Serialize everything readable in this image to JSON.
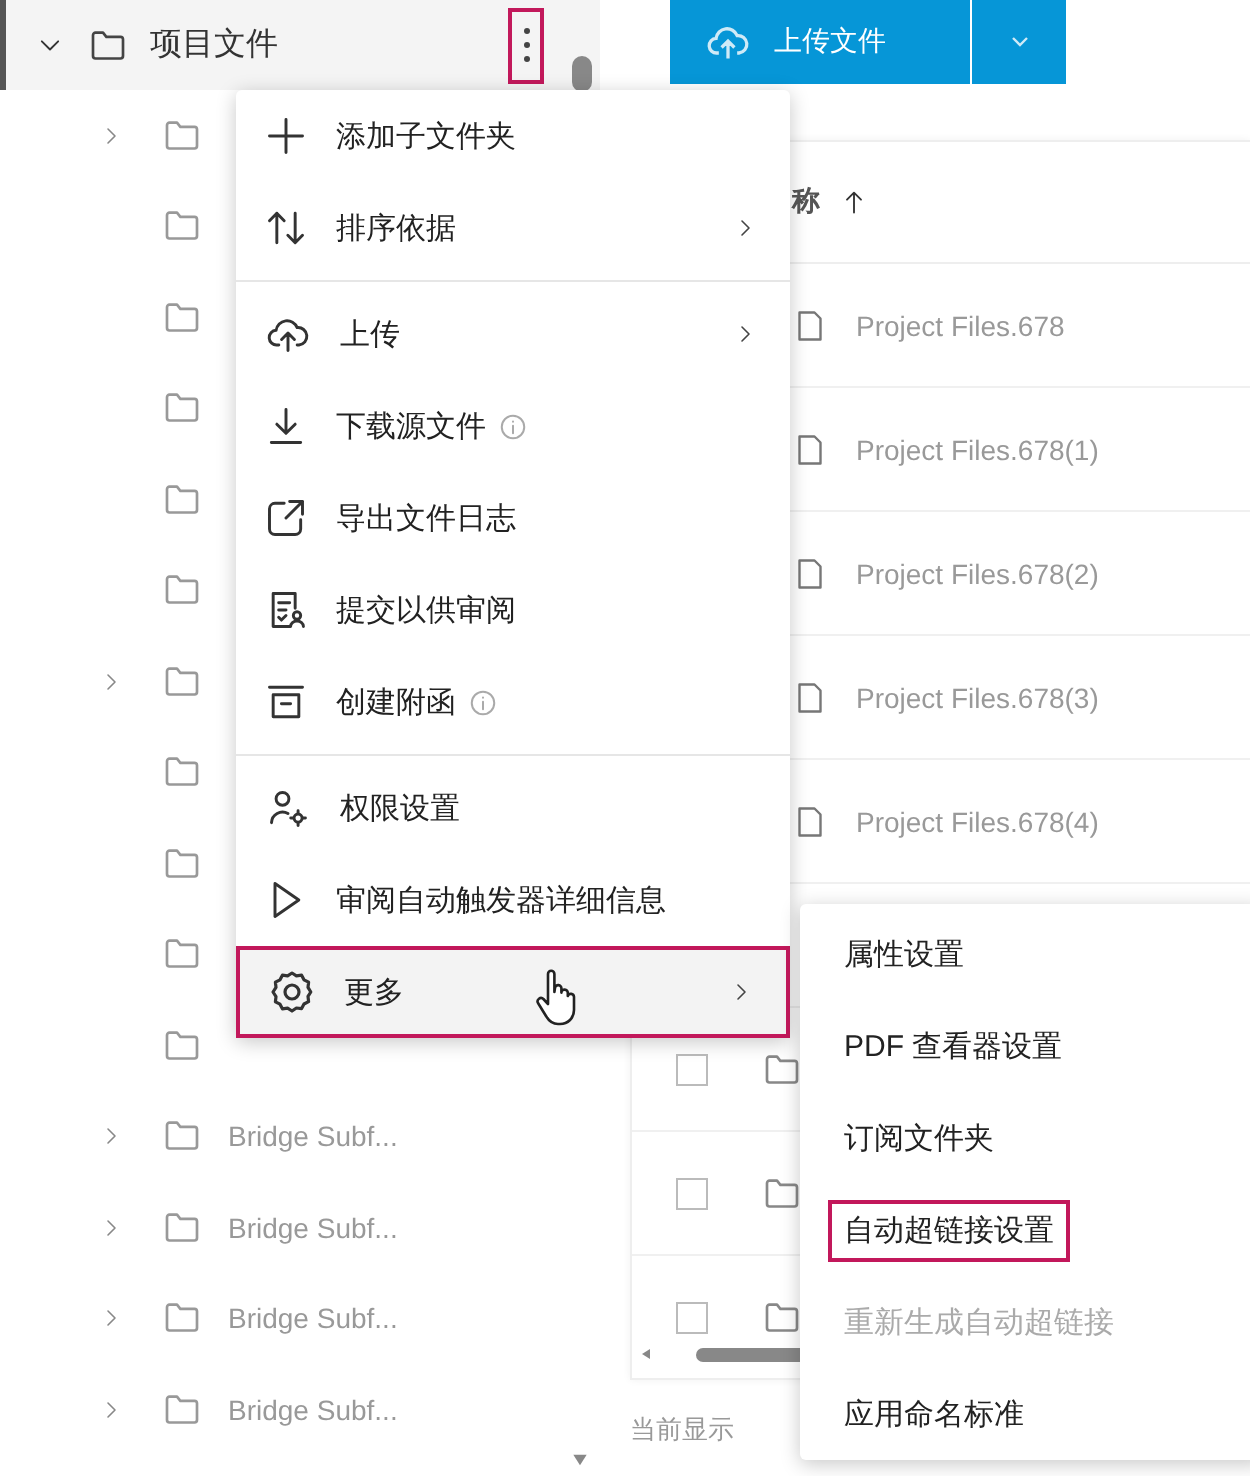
{
  "tree": {
    "root": {
      "label": "项目文件",
      "expanded": true
    },
    "children": [
      {
        "expandable": true
      },
      {
        "expandable": false
      },
      {
        "expandable": false
      },
      {
        "expandable": false
      },
      {
        "expandable": false
      },
      {
        "expandable": false
      },
      {
        "expandable": true
      },
      {
        "expandable": false
      },
      {
        "expandable": false
      },
      {
        "expandable": false
      },
      {
        "expandable": false
      },
      {
        "expandable": true,
        "label": "Bridge Subf..."
      },
      {
        "expandable": true,
        "label": "Bridge Subf..."
      },
      {
        "expandable": true,
        "label": "Bridge Subf..."
      },
      {
        "expandable": true,
        "label": "Bridge Subf..."
      }
    ]
  },
  "upload_button": {
    "label": "上传文件"
  },
  "table": {
    "header": {
      "label": "称",
      "sort_ascending": true
    },
    "rows": [
      {
        "kind": "file",
        "name": "Project Files.678"
      },
      {
        "kind": "file",
        "name": "Project Files.678(1)"
      },
      {
        "kind": "file",
        "name": "Project Files.678(2)"
      },
      {
        "kind": "file",
        "name": "Project Files.678(3)"
      },
      {
        "kind": "file",
        "name": "Project Files.678(4)"
      },
      {
        "kind": "hidden"
      },
      {
        "kind": "folder",
        "checked": false
      },
      {
        "kind": "folder",
        "checked": false
      },
      {
        "kind": "folder",
        "checked": false
      }
    ],
    "footer": "当前显示"
  },
  "context_menu": {
    "items": [
      {
        "kind": "item",
        "label": "添加子文件夹",
        "submenu": false,
        "info": false,
        "selected": false
      },
      {
        "kind": "item",
        "label": "排序依据",
        "submenu": true,
        "info": false,
        "selected": false
      },
      {
        "kind": "divider"
      },
      {
        "kind": "item",
        "label": "上传",
        "submenu": true,
        "info": false,
        "selected": false
      },
      {
        "kind": "item",
        "label": "下载源文件",
        "submenu": false,
        "info": true,
        "selected": false
      },
      {
        "kind": "item",
        "label": "导出文件日志",
        "submenu": false,
        "info": false,
        "selected": false
      },
      {
        "kind": "item",
        "label": "提交以供审阅",
        "submenu": false,
        "info": false,
        "selected": false
      },
      {
        "kind": "item",
        "label": "创建附函",
        "submenu": false,
        "info": true,
        "selected": false
      },
      {
        "kind": "divider"
      },
      {
        "kind": "item",
        "label": "权限设置",
        "submenu": false,
        "info": false,
        "selected": false
      },
      {
        "kind": "item",
        "label": "审阅自动触发器详细信息",
        "submenu": false,
        "info": false,
        "selected": false
      },
      {
        "kind": "item",
        "label": "更多",
        "submenu": true,
        "info": false,
        "selected": true
      }
    ]
  },
  "submenu": {
    "items": [
      {
        "label": "属性设置",
        "disabled": false,
        "selected": false
      },
      {
        "label": "PDF 查看器设置",
        "disabled": false,
        "selected": false
      },
      {
        "label": "订阅文件夹",
        "disabled": false,
        "selected": false
      },
      {
        "label": "自动超链接设置",
        "disabled": false,
        "selected": true
      },
      {
        "label": "重新生成自动超链接",
        "disabled": true,
        "selected": false
      },
      {
        "label": "应用命名标准",
        "disabled": false,
        "selected": false
      }
    ]
  }
}
